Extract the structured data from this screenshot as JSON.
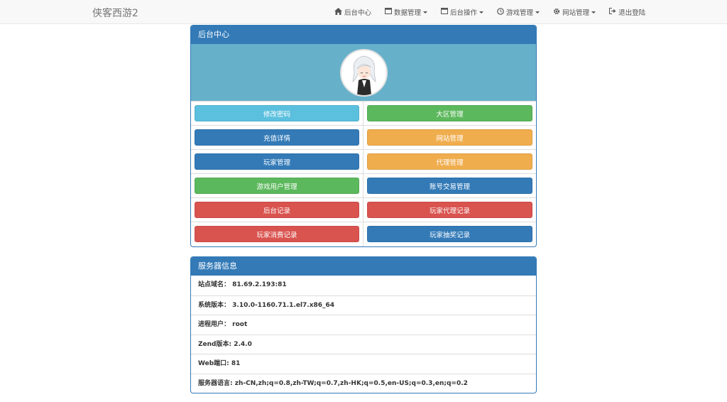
{
  "navbar": {
    "brand": "侠客西游2",
    "items": [
      {
        "label": "后台中心",
        "icon": "home-icon",
        "dropdown": false
      },
      {
        "label": "数据管理",
        "icon": "window-icon",
        "dropdown": true
      },
      {
        "label": "后台操作",
        "icon": "window-icon",
        "dropdown": true
      },
      {
        "label": "游戏管理",
        "icon": "clock-icon",
        "dropdown": true
      },
      {
        "label": "网站管理",
        "icon": "gear-icon",
        "dropdown": true
      },
      {
        "label": "退出登陆",
        "icon": "logout-icon",
        "dropdown": false
      }
    ]
  },
  "admin_panel": {
    "title": "后台中心",
    "buttons": [
      {
        "label": "修改密码",
        "color": "#5bc0de"
      },
      {
        "label": "大区管理",
        "color": "#5cb85c"
      },
      {
        "label": "充值详情",
        "color": "#337ab7"
      },
      {
        "label": "网站管理",
        "color": "#f0ad4e"
      },
      {
        "label": "玩家管理",
        "color": "#337ab7"
      },
      {
        "label": "代理管理",
        "color": "#f0ad4e"
      },
      {
        "label": "游戏用户管理",
        "color": "#5cb85c"
      },
      {
        "label": "账号交易管理",
        "color": "#337ab7"
      },
      {
        "label": "后台记录",
        "color": "#d9534f"
      },
      {
        "label": "玩家代理记录",
        "color": "#d9534f"
      },
      {
        "label": "玩家消费记录",
        "color": "#d9534f"
      },
      {
        "label": "玩家抽奖记录",
        "color": "#337ab7"
      }
    ]
  },
  "server_panel": {
    "title": "服务器信息",
    "rows": [
      "站点域名： 81.69.2.193:81",
      "系统版本： 3.10.0-1160.71.1.el7.x86_64",
      "进程用户： root",
      "Zend版本: 2.4.0",
      "Web端口: 81",
      "服务器语言: zh-CN,zh;q=0.8,zh-TW;q=0.7,zh-HK;q=0.5,en-US;q=0.3,en;q=0.2"
    ]
  },
  "colors": {
    "primary": "#337ab7",
    "info": "#5bc0de",
    "success": "#5cb85c",
    "warning": "#f0ad4e",
    "danger": "#d9534f",
    "avatar_bg": "#67b0ca"
  }
}
